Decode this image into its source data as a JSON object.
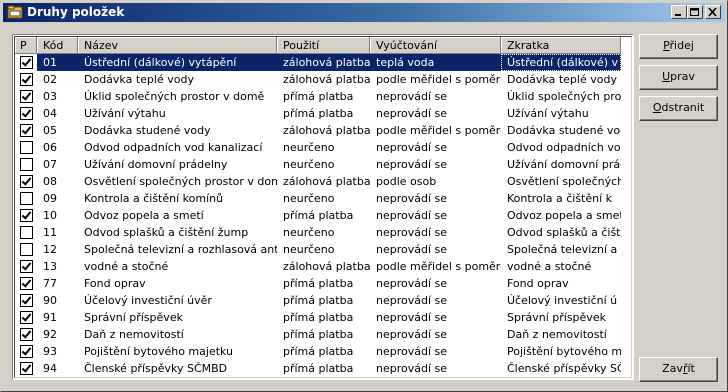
{
  "window": {
    "title": "Druhy položek"
  },
  "columns": [
    "P",
    "Kód",
    "Název",
    "Použití",
    "Vyúčtování",
    "Zkratka"
  ],
  "rows": [
    {
      "p": true,
      "kod": "01",
      "nazev": "Ústřední (dálkové) vytápění",
      "pouziti": "zálohová platba",
      "vyuctovani": "teplá voda",
      "zkratka": "Ústřední (dálkové) v",
      "selected": true
    },
    {
      "p": true,
      "kod": "02",
      "nazev": "Dodávka teplé vody",
      "pouziti": "zálohová platba",
      "vyuctovani": "podle měřidel s poměrem",
      "zkratka": "Dodávka teplé vody"
    },
    {
      "p": true,
      "kod": "03",
      "nazev": "Úklid společných prostor v domě",
      "pouziti": "přímá platba",
      "vyuctovani": "neprovádí se",
      "zkratka": "Úklid společných pro"
    },
    {
      "p": true,
      "kod": "04",
      "nazev": "Užívání výtahu",
      "pouziti": "přímá platba",
      "vyuctovani": "neprovádí se",
      "zkratka": "Užívání výtahu"
    },
    {
      "p": true,
      "kod": "05",
      "nazev": "Dodávka studené vody",
      "pouziti": "zálohová platba",
      "vyuctovani": "podle měřidel s poměrem",
      "zkratka": "Dodávka studené vody"
    },
    {
      "p": false,
      "kod": "06",
      "nazev": "Odvod odpadních vod kanalizací",
      "pouziti": "neurčeno",
      "vyuctovani": "neprovádí se",
      "zkratka": "Odvod odpadních vod"
    },
    {
      "p": false,
      "kod": "07",
      "nazev": "Užívání domovní prádelny",
      "pouziti": "neurčeno",
      "vyuctovani": "neprovádí se",
      "zkratka": "Užívání domovní prád"
    },
    {
      "p": true,
      "kod": "08",
      "nazev": "Osvětlení společných prostor v domě",
      "pouziti": "zálohová platba",
      "vyuctovani": "podle osob",
      "zkratka": "Osvětlení společných"
    },
    {
      "p": false,
      "kod": "09",
      "nazev": "Kontrola a čištění komínů",
      "pouziti": "neurčeno",
      "vyuctovani": "neprovádí se",
      "zkratka": "Kontrola a čištění k"
    },
    {
      "p": true,
      "kod": "10",
      "nazev": "Odvoz popela a smetí",
      "pouziti": "přímá platba",
      "vyuctovani": "neprovádí se",
      "zkratka": "Odvoz popela a smetí"
    },
    {
      "p": false,
      "kod": "11",
      "nazev": "Odvod splašků a čištění žump",
      "pouziti": "neurčeno",
      "vyuctovani": "neprovádí se",
      "zkratka": "Odvod splašků a čišt"
    },
    {
      "p": false,
      "kod": "12",
      "nazev": "Společná televizní a rozhlasová anténa",
      "pouziti": "neurčeno",
      "vyuctovani": "neprovádí se",
      "zkratka": "Společná televizní a"
    },
    {
      "p": true,
      "kod": "13",
      "nazev": "vodné a stočné",
      "pouziti": "zálohová platba",
      "vyuctovani": "podle měřidel s poměrem",
      "zkratka": "vodné a stočné"
    },
    {
      "p": true,
      "kod": "77",
      "nazev": "Fond oprav",
      "pouziti": "přímá platba",
      "vyuctovani": "neprovádí se",
      "zkratka": "Fond oprav"
    },
    {
      "p": true,
      "kod": "90",
      "nazev": "Účelový investiční úvěr",
      "pouziti": "přímá platba",
      "vyuctovani": "neprovádí se",
      "zkratka": "Účelový investiční ú"
    },
    {
      "p": true,
      "kod": "91",
      "nazev": "Správní příspěvek",
      "pouziti": "přímá platba",
      "vyuctovani": "neprovádí se",
      "zkratka": "Správní příspěvek"
    },
    {
      "p": true,
      "kod": "92",
      "nazev": "Daň z nemovitostí",
      "pouziti": "přímá platba",
      "vyuctovani": "neprovádí se",
      "zkratka": "Daň z nemovitostí"
    },
    {
      "p": true,
      "kod": "93",
      "nazev": "Pojištění bytového majetku",
      "pouziti": "přímá platba",
      "vyuctovani": "neprovádí se",
      "zkratka": "Pojištění bytového m"
    },
    {
      "p": true,
      "kod": "94",
      "nazev": "Členské příspěvky SČMBD",
      "pouziti": "přímá platba",
      "vyuctovani": "neprovádí se",
      "zkratka": "Členské příspěvky SČ"
    }
  ],
  "buttons": {
    "pridej": {
      "before": "",
      "key": "P",
      "after": "řidej"
    },
    "uprav": {
      "before": "",
      "key": "U",
      "after": "prav"
    },
    "odstranit": {
      "before": "",
      "key": "O",
      "after": "dstranit"
    },
    "zavrit": {
      "before": "Zav",
      "key": "ř",
      "after": "ít"
    }
  },
  "icons": {
    "app": "folder-window-icon",
    "minimize": "minimize-icon",
    "maximize": "maximize-icon",
    "close": "close-icon"
  }
}
